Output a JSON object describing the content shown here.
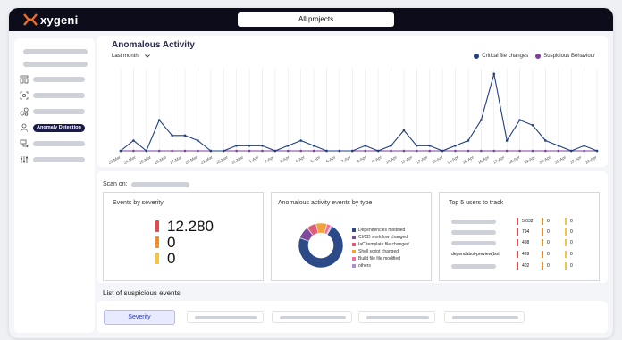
{
  "brand": {
    "name": "xygeni",
    "color": "#f26c21"
  },
  "header": {
    "project_selector": "All projects"
  },
  "sidebar": {
    "items": [
      {
        "icon": "grid-icon"
      },
      {
        "icon": "scan-target-icon"
      },
      {
        "icon": "nodes-icon"
      },
      {
        "icon": "user-shield-icon",
        "label": "Anomaly Detection"
      },
      {
        "icon": "pipeline-icon"
      },
      {
        "icon": "sliders-icon"
      }
    ]
  },
  "anomalous_activity": {
    "title": "Anomalous Activity",
    "period": "Last month",
    "legend": [
      {
        "label": "Critical file changes",
        "color": "#1f3f7f"
      },
      {
        "label": "Suspicious Behaviour",
        "color": "#7b3f9e"
      }
    ]
  },
  "chart_data": {
    "type": "line",
    "title": "Anomalous Activity",
    "x": [
      "23-Mar",
      "24-Mar",
      "25-Mar",
      "26-Mar",
      "27-Mar",
      "28-Mar",
      "29-Mar",
      "30-Mar",
      "31-Mar",
      "1-Apr",
      "2-Apr",
      "3-Apr",
      "4-Apr",
      "5-Apr",
      "6-Apr",
      "7-Apr",
      "8-Apr",
      "9-Apr",
      "10-Apr",
      "11-Apr",
      "12-Apr",
      "13-Apr",
      "14-Apr",
      "15-Apr",
      "16-Apr",
      "17-Apr",
      "18-Apr",
      "19-Apr",
      "20-Apr",
      "21-Apr",
      "22-Apr",
      "23-Apr"
    ],
    "series": [
      {
        "name": "Critical file changes",
        "color": "#1f3f7f",
        "values": [
          0,
          2,
          0,
          6,
          3,
          3,
          2,
          0,
          0,
          1,
          1,
          1,
          0,
          1,
          2,
          1,
          0,
          0,
          0,
          1,
          0,
          1,
          4,
          1,
          1,
          0,
          1,
          2,
          6,
          15,
          2,
          6,
          5,
          2,
          1,
          0,
          1,
          0
        ]
      },
      {
        "name": "Suspicious Behaviour",
        "color": "#7b3f9e",
        "values": [
          0,
          0,
          0,
          0,
          0,
          0,
          0,
          0,
          0,
          0,
          0,
          0,
          0,
          0,
          0,
          0,
          0,
          0,
          0,
          0,
          0,
          0,
          0,
          0,
          0,
          0,
          0,
          0,
          0,
          0,
          0,
          0,
          0,
          0,
          0,
          0,
          0,
          0
        ]
      }
    ],
    "ylim": [
      0,
      16
    ],
    "grid": "vertical",
    "legend_position": "top-right"
  },
  "scan": {
    "label": "Scan on:"
  },
  "events_by_severity": {
    "title": "Events by severity",
    "rows": [
      {
        "value": "12.280",
        "color": "#e5484d"
      },
      {
        "value": "0",
        "color": "#f28c28"
      },
      {
        "value": "0",
        "color": "#f5c542"
      }
    ]
  },
  "events_by_type": {
    "title": "Anomalous activity events by type",
    "slices": [
      {
        "label": "Dependencies modified",
        "value": 72,
        "color": "#2b4a87"
      },
      {
        "label": "CI/CD workflow changed",
        "value": 9,
        "color": "#7d4a9c"
      },
      {
        "label": "IaC template file changed",
        "value": 7,
        "color": "#e05b7a"
      },
      {
        "label": "Shell script changed",
        "value": 8,
        "color": "#f2a23a"
      },
      {
        "label": "Build file file modified",
        "value": 3,
        "color": "#f06fa0"
      },
      {
        "label": "others",
        "value": 1,
        "color": "#b08bd8"
      }
    ]
  },
  "top_users": {
    "title": "Top 5 users to track",
    "rows": [
      {
        "user": "",
        "critical": "5.032",
        "high": "0",
        "medium": "0"
      },
      {
        "user": "",
        "critical": "794",
        "high": "0",
        "medium": "0"
      },
      {
        "user": "",
        "critical": "498",
        "high": "0",
        "medium": "0"
      },
      {
        "user": "dependabot-preview[bot]",
        "critical": "439",
        "high": "0",
        "medium": "0"
      },
      {
        "user": "",
        "critical": "402",
        "high": "0",
        "medium": "0"
      }
    ]
  },
  "suspicious_events": {
    "title": "List of suspicious events",
    "severity_button": "Severity"
  }
}
